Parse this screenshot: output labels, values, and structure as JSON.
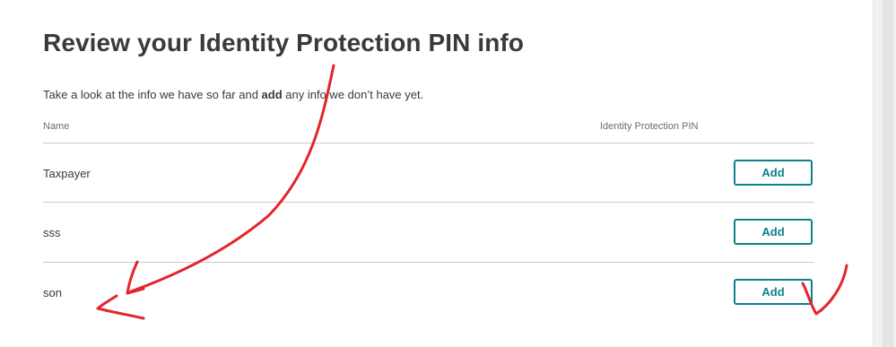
{
  "page": {
    "title": "Review your Identity Protection PIN info",
    "subtitle_before": "Take a look at the info we have so far and ",
    "subtitle_bold": "add",
    "subtitle_after": " any info we don’t have yet."
  },
  "table": {
    "columns": [
      "Name",
      "Identity Protection PIN"
    ],
    "rows": [
      {
        "name": "Taxpayer",
        "action_label": "Add"
      },
      {
        "name": "sss",
        "action_label": "Add"
      },
      {
        "name": "son",
        "action_label": "Add"
      }
    ]
  },
  "colors": {
    "accent": "#0d7f8c",
    "annotation": "#e3242b",
    "text": "#393a3d"
  }
}
